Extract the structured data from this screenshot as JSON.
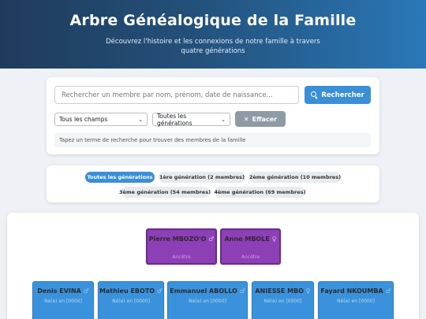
{
  "header": {
    "title": "Arbre Généalogique de la Famille",
    "subtitle": "Découvrez l'histoire et les connexions de notre famille à travers quatre générations"
  },
  "search": {
    "placeholder": "Rechercher un membre par nom, prénom, date de naissance...",
    "button_label": "Rechercher",
    "field_select": "Tous les champs",
    "generation_select": "Toutes les générations",
    "clear_label": "Effacer",
    "hint": "Tapez un terme de recherche pour trouver des membres de la famille"
  },
  "filters": [
    {
      "label": "Toutes les générations",
      "active": true
    },
    {
      "label": "1ère génération (2 membres)",
      "active": false
    },
    {
      "label": "2ème génération (10 membres)",
      "active": false
    },
    {
      "label": "3ème génération (54 membres)",
      "active": false
    },
    {
      "label": "4ème génération (69 membres)",
      "active": false
    }
  ],
  "tree": {
    "generation1": [
      {
        "name": "Pierre MBOZO'O",
        "gender_symbol": "♂",
        "detail": "Ancêtre"
      },
      {
        "name": "Anne MBOLE",
        "gender_symbol": "♀",
        "detail": "Ancêtre"
      }
    ],
    "generation2": [
      {
        "name": "Denis EVINA",
        "gender_symbol": "♂",
        "detail": "Né(e) en [0000]"
      },
      {
        "name": "Mathieu EBOTO",
        "gender_symbol": "♂",
        "detail": "Né(e) en [0000]"
      },
      {
        "name": "Emmanuel ABOLLO",
        "gender_symbol": "♂",
        "detail": "Né(e) en [0000]"
      },
      {
        "name": "ANIESSE MBO",
        "gender_symbol": "♀",
        "detail": "Né(e) en [0000]"
      },
      {
        "name": "Fayard NKOUMBA",
        "gender_symbol": "♂",
        "detail": "Né(e) en [0000]"
      }
    ]
  },
  "colors": {
    "header_start": "#1f3b5c",
    "header_end": "#2a78b8",
    "accent": "#3a8fd6",
    "generation1": "#8d3fb6",
    "generation2": "#3a92dc",
    "clear_button": "#8e9aa5"
  }
}
